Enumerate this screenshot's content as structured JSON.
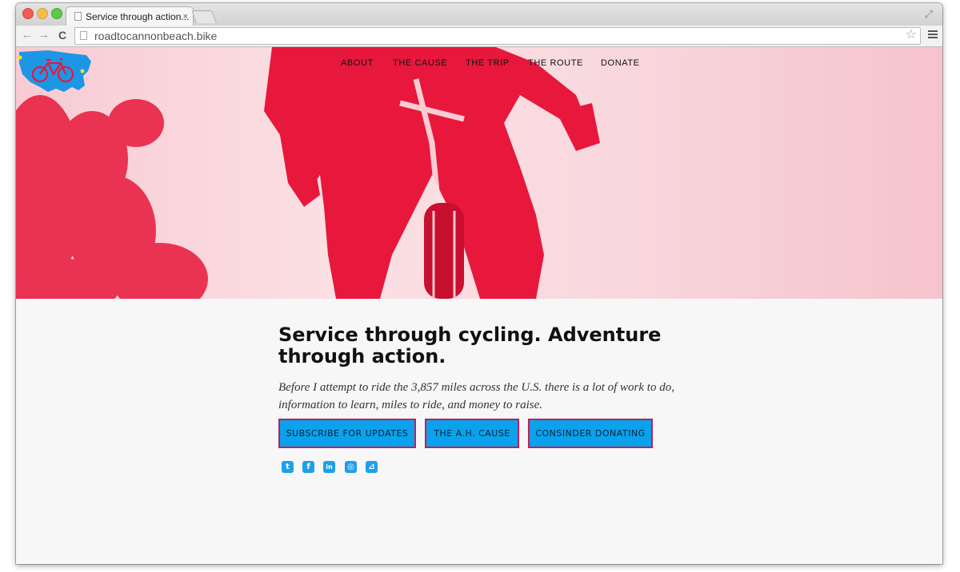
{
  "browser": {
    "tab_title": "Service through action...",
    "tab_close": "×",
    "url": "roadtocannonbeach.bike",
    "back_glyph": "←",
    "forward_glyph": "→",
    "reload_glyph": "C",
    "star_glyph": "☆",
    "restore_glyph": "⤢"
  },
  "nav": {
    "items": [
      "ABOUT",
      "THE CAUSE",
      "THE TRIP",
      "THE ROUTE",
      "DONATE"
    ]
  },
  "main": {
    "headline": "Service through cycling. Adventure through action.",
    "lede": "Before I attempt to ride the 3,857 miles across the U.S. there is a lot of work to do, information to learn, miles to ride, and money to raise.",
    "buttons": {
      "subscribe": "SUBSCRIBE FOR UPDATES",
      "cause": "THE A.H. CAUSE",
      "donate": "CONSINDER DONATING"
    },
    "socials": [
      {
        "icon": "twitter-icon",
        "glyph": "t"
      },
      {
        "icon": "facebook-icon",
        "glyph": "f"
      },
      {
        "icon": "linkedin-icon",
        "glyph": "in"
      },
      {
        "icon": "instagram-icon",
        "glyph": "◎"
      },
      {
        "icon": "rss-icon",
        "glyph": "⊿"
      }
    ]
  },
  "colors": {
    "hero_red": "#e8173c",
    "button_blue": "#0aa1ed",
    "button_border": "#c21f55",
    "logo_blue": "#1e96e6"
  }
}
